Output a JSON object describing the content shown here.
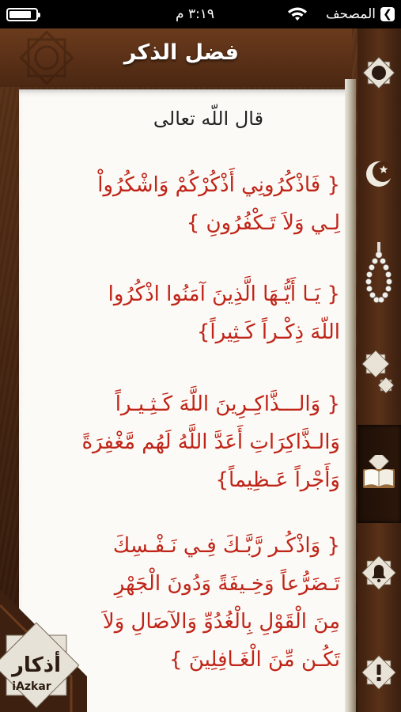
{
  "status_bar": {
    "carrier": "المصحف",
    "time": "٣:١٩ م",
    "battery_level": 0.85
  },
  "header": {
    "title": "فضل الذكر"
  },
  "content": {
    "heading": "قال اللّه تعالى",
    "verses": [
      "{ فَاذْكُرُونِي أَذْكُرْكُمْ وَاشْكُرُواْ\nلِـي وَلاَ تَـكْفُرُونِ }",
      "{ يَـا أَيُّـهَا الَّذِينَ آمَنُوا اذْكُرُوا\nاللّهَ ذِكْـراً كَـثِيراً}",
      "{ وَالـــذَّاكِـرِينَ اللَّهَ كَـثِـيـراً\nوَالـذَّاكِرَاتِ أَعَدَّ اللَّهُ لَهُم مَّغْفِرَةً\nوَأَجْراً عَـظِيماً}",
      "{ وَاذْكُـر رَّبَّـكَ فِـي نَـفْـسِكَ\nتَـضَرُّعاً وَخِـيفَةً وَدُونَ الْجَهْرِ\nمِنَ الْقَوْلِ بِالْغُدُوِّ وَالآصَالِ وَلاَ\nتَكُـن مِّنَ الْغَـافِلِينَ }"
    ]
  },
  "sidebar": {
    "items": [
      {
        "icon": "star-badge-icon"
      },
      {
        "icon": "crescent-icon"
      },
      {
        "icon": "prayer-beads-icon"
      },
      {
        "icon": "stars-icon"
      },
      {
        "icon": "open-book-icon",
        "selected": true
      },
      {
        "icon": "bell-icon"
      },
      {
        "icon": "alert-icon"
      }
    ]
  },
  "logo": {
    "arabic": "أذكار",
    "latin": "iAzkar"
  },
  "colors": {
    "verse": "#c02418",
    "leather": "#4b2712",
    "page": "#fbfaf6"
  }
}
